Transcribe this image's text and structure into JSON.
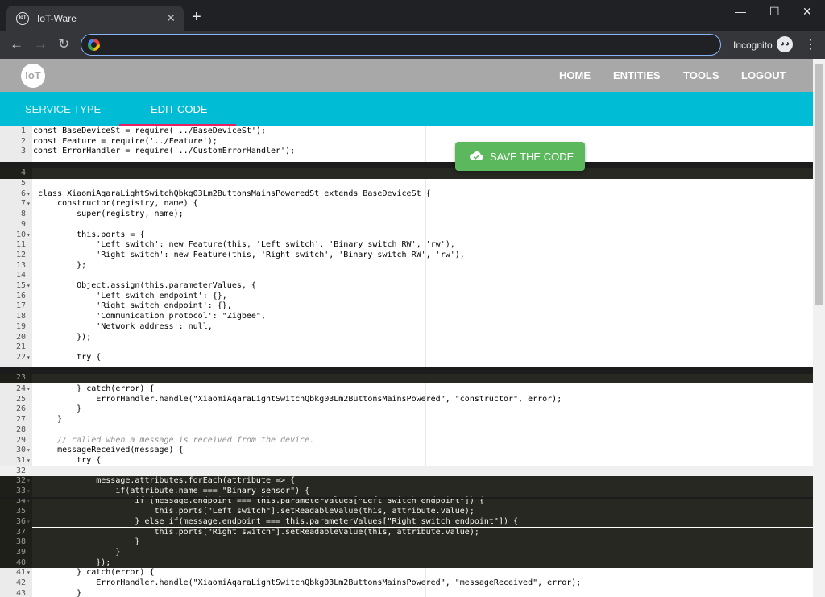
{
  "browser": {
    "tab_title": "IoT-Ware",
    "tab_favicon": "IoT",
    "incognito_label": "Incognito",
    "url": ""
  },
  "header": {
    "logo": "IoT",
    "nav": [
      "HOME",
      "ENTITIES",
      "TOOLS",
      "LOGOUT"
    ]
  },
  "subnav": {
    "tabs": [
      "SERVICE TYPE",
      "EDIT CODE"
    ],
    "active": "EDIT CODE"
  },
  "save_button": {
    "label": "SAVE THE CODE",
    "color": "#5cb85c"
  },
  "code_lines": [
    {
      "n": "1",
      "t": "const BaseDeviceSt = require('../BaseDeviceSt');"
    },
    {
      "n": "2",
      "t": "const Feature = require('../Feature');"
    },
    {
      "n": "3",
      "t": "const ErrorHandler = require('../CustomErrorHandler');"
    },
    {
      "n": "4",
      "t": "",
      "dark": true
    },
    {
      "n": "5",
      "t": ""
    },
    {
      "n": "6",
      "t": "class XiaomiAqaraLightSwitchQbkg03Lm2ButtonsMainsPoweredSt extends BaseDeviceSt {",
      "fold": true
    },
    {
      "n": "7",
      "t": "    constructor(registry, name) {",
      "fold": true
    },
    {
      "n": "8",
      "t": "        super(registry, name);"
    },
    {
      "n": "9",
      "t": ""
    },
    {
      "n": "10",
      "t": "        this.ports = {",
      "fold": true
    },
    {
      "n": "11",
      "t": "            'Left switch': new Feature(this, 'Left switch', 'Binary switch RW', 'rw'),"
    },
    {
      "n": "12",
      "t": "            'Right switch': new Feature(this, 'Right switch', 'Binary switch RW', 'rw'),"
    },
    {
      "n": "13",
      "t": "        };"
    },
    {
      "n": "14",
      "t": ""
    },
    {
      "n": "15",
      "t": "        Object.assign(this.parameterValues, {",
      "fold": true
    },
    {
      "n": "16",
      "t": "            'Left switch endpoint': {},"
    },
    {
      "n": "17",
      "t": "            'Right switch endpoint': {},"
    },
    {
      "n": "18",
      "t": "            'Communication protocol': \"Zigbee\","
    },
    {
      "n": "19",
      "t": "            'Network address': null,"
    },
    {
      "n": "20",
      "t": "        });"
    },
    {
      "n": "21",
      "t": ""
    },
    {
      "n": "22",
      "t": "        try {",
      "fold": true
    },
    {
      "n": "23",
      "t": "",
      "dark": true
    },
    {
      "n": "24",
      "t": "        } catch(error) {",
      "fold": true
    },
    {
      "n": "25",
      "t": "            ErrorHandler.handle(\"XiaomiAqaraLightSwitchQbkg03Lm2ButtonsMainsPowered\", \"constructor\", error);"
    },
    {
      "n": "26",
      "t": "        }"
    },
    {
      "n": "27",
      "t": "    }"
    },
    {
      "n": "28",
      "t": ""
    },
    {
      "n": "29",
      "t": "    // called when a message is received from the device."
    },
    {
      "n": "30",
      "t": "    messageReceived(message) {",
      "fold": true
    },
    {
      "n": "31",
      "t": "        try {",
      "fold": true
    },
    {
      "n": "32",
      "t": "",
      "active": true
    },
    {
      "n": "32",
      "t": "            message.attributes.forEach(attribute => {",
      "dark": true,
      "fold": true
    },
    {
      "n": "33",
      "t": "                if(attribute.name === \"Binary sensor\") {",
      "dark": true,
      "fold": true
    },
    {
      "n": "34",
      "t": "                    if (message.endpoint === this.parameterValues[\"Left switch endpoint\"]) {",
      "dark": true,
      "fold": true
    },
    {
      "n": "35",
      "t": "                        this.ports[\"Left switch\"].setReadableValue(this, attribute.value);",
      "dark": true
    },
    {
      "n": "36",
      "t": "                    } else if(message.endpoint === this.parameterValues[\"Right switch endpoint\"]) {",
      "dark": true,
      "fold": true
    },
    {
      "n": "37",
      "t": "                        this.ports[\"Right switch\"].setReadableValue(this, attribute.value);",
      "dark": true
    },
    {
      "n": "38",
      "t": "                    }",
      "dark": true
    },
    {
      "n": "39",
      "t": "                }",
      "dark": true
    },
    {
      "n": "40",
      "t": "            });",
      "dark": true
    },
    {
      "n": "41",
      "t": "        } catch(error) {",
      "fold": true
    },
    {
      "n": "42",
      "t": "            ErrorHandler.handle(\"XiaomiAqaraLightSwitchQbkg03Lm2ButtonsMainsPowered\", \"messageReceived\", error);"
    },
    {
      "n": "43",
      "t": "        }"
    }
  ]
}
